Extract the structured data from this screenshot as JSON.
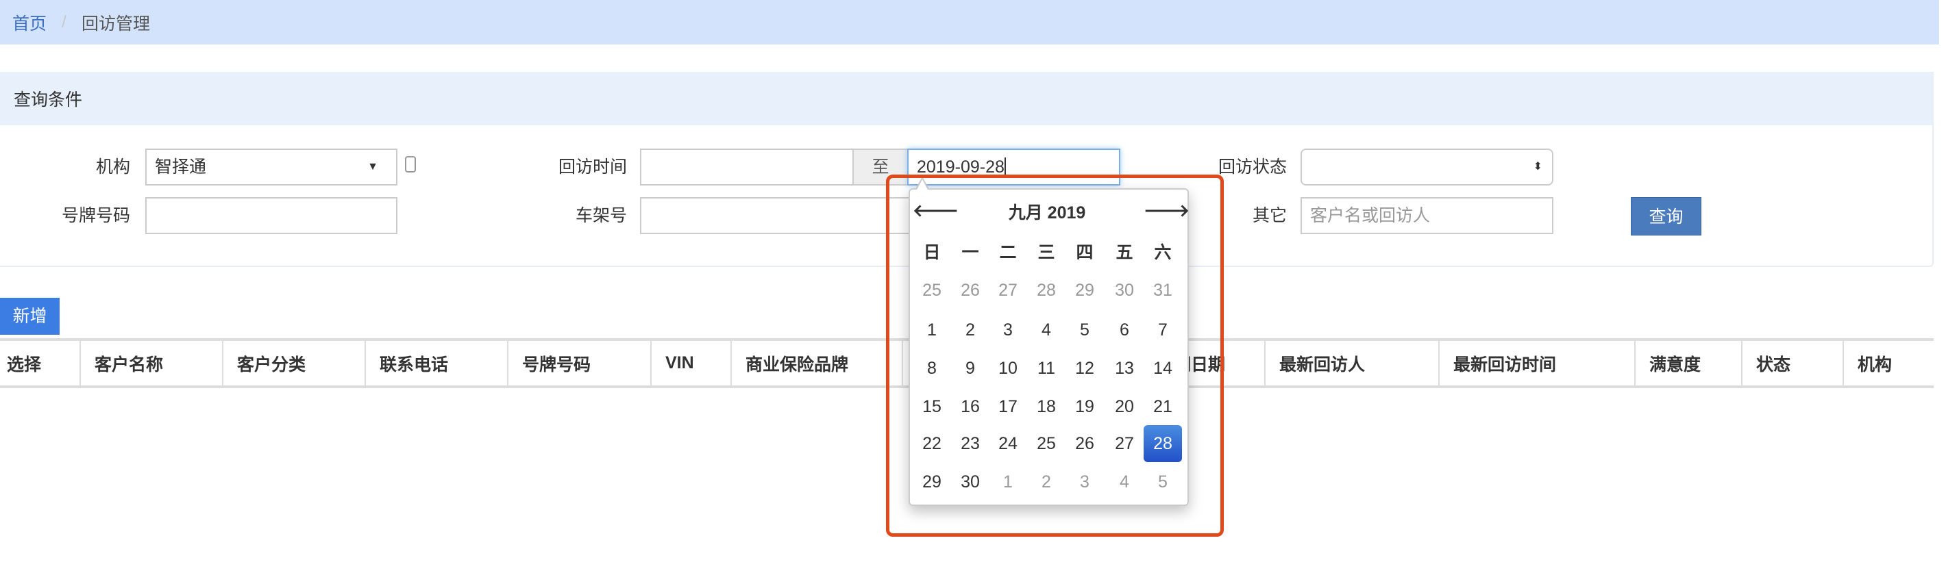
{
  "breadcrumb": {
    "home": "首页",
    "separator": "/",
    "current": "回访管理"
  },
  "panel": {
    "title": "查询条件"
  },
  "form": {
    "org_label": "机构",
    "org_value": "智择通",
    "visit_time_label": "回访时间",
    "visit_time_from": "",
    "to_label": "至",
    "visit_time_to": "2019-09-28",
    "visit_status_label": "回访状态",
    "visit_status_value": "",
    "plate_label": "号牌号码",
    "plate_value": "",
    "vin_label": "车架号",
    "vin_value": "",
    "other_label": "其它",
    "other_placeholder": "客户名或回访人",
    "query_button": "查询"
  },
  "add_button": "新增",
  "table": {
    "headers": [
      "选择",
      "客户名称",
      "客户分类",
      "联系电话",
      "号牌号码",
      "VIN",
      "商业保险品牌",
      "",
      "到期日期",
      "最新回访人",
      "最新回访时间",
      "满意度",
      "状态",
      "机构"
    ]
  },
  "calendar": {
    "title": "九月 2019",
    "prev": "🡐",
    "next": "🡒",
    "weekdays": [
      "日",
      "一",
      "二",
      "三",
      "四",
      "五",
      "六"
    ],
    "weeks": [
      [
        "25",
        "26",
        "27",
        "28",
        "29",
        "30",
        "31"
      ],
      [
        "1",
        "2",
        "3",
        "4",
        "5",
        "6",
        "7"
      ],
      [
        "8",
        "9",
        "10",
        "11",
        "12",
        "13",
        "14"
      ],
      [
        "15",
        "16",
        "17",
        "18",
        "19",
        "20",
        "21"
      ],
      [
        "22",
        "23",
        "24",
        "25",
        "26",
        "27",
        "28"
      ],
      [
        "29",
        "30",
        "1",
        "2",
        "3",
        "4",
        "5"
      ]
    ],
    "selected": "28",
    "selected_color": "#2d62d0",
    "highlight_color": "#e04a1a"
  }
}
